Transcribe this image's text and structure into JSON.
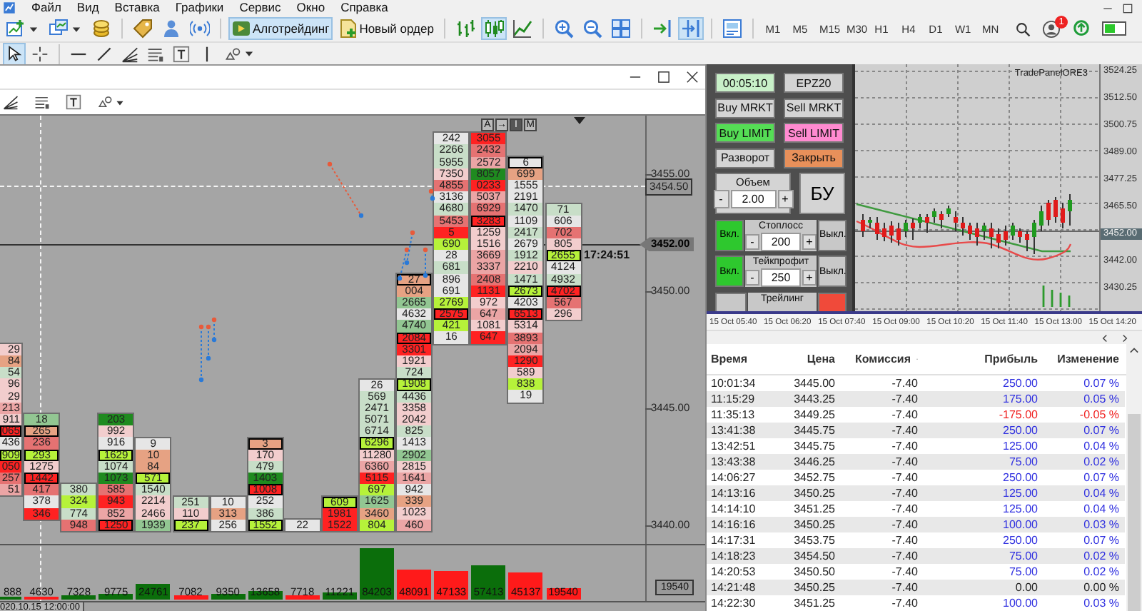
{
  "menu": {
    "items": [
      "Файл",
      "Вид",
      "Вставка",
      "Графики",
      "Сервис",
      "Окно",
      "Справка"
    ]
  },
  "toolbar": [
    {
      "kind": "new-chart",
      "pressed": false
    },
    {
      "kind": "profiles",
      "pressed": false
    },
    {
      "kind": "coins",
      "pressed": false
    },
    {
      "kind": "separator"
    },
    {
      "kind": "market",
      "pressed": false
    },
    {
      "kind": "person",
      "pressed": false
    },
    {
      "kind": "signal",
      "pressed": false
    },
    {
      "kind": "separator"
    },
    {
      "kind": "algo",
      "label": "Алготрейдинг",
      "pressed": true
    },
    {
      "kind": "order",
      "label": "Новый ордер",
      "pressed": false
    },
    {
      "kind": "separator"
    },
    {
      "kind": "bars",
      "pressed": false
    },
    {
      "kind": "candles",
      "pressed": true
    },
    {
      "kind": "line",
      "pressed": false
    },
    {
      "kind": "separator"
    },
    {
      "kind": "zoom-in",
      "pressed": false
    },
    {
      "kind": "zoom-out",
      "pressed": false
    },
    {
      "kind": "tile",
      "pressed": false
    },
    {
      "kind": "separator"
    },
    {
      "kind": "shift",
      "pressed": false
    },
    {
      "kind": "autoscroll",
      "pressed": true
    },
    {
      "kind": "separator"
    },
    {
      "kind": "template",
      "pressed": false
    },
    {
      "kind": "separator"
    }
  ],
  "timeframes": [
    {
      "label": "M1",
      "selected": false
    },
    {
      "label": "M5",
      "selected": false
    },
    {
      "label": "M15",
      "selected": false
    },
    {
      "label": "M30",
      "selected": false
    },
    {
      "label": "H1",
      "selected": false
    },
    {
      "label": "H4",
      "selected": false
    },
    {
      "label": "D1",
      "selected": false
    },
    {
      "label": "W1",
      "selected": false
    },
    {
      "label": "MN",
      "selected": false
    }
  ],
  "notifications": {
    "badge": "1"
  },
  "drawing_tools": [
    {
      "kind": "cursor",
      "pressed": true
    },
    {
      "kind": "crosshair",
      "pressed": false
    },
    {
      "kind": "separator"
    },
    {
      "kind": "hline",
      "pressed": false
    },
    {
      "kind": "trend",
      "pressed": false
    },
    {
      "kind": "fan",
      "pressed": false
    },
    {
      "kind": "levels",
      "pressed": false
    },
    {
      "kind": "text",
      "pressed": false
    },
    {
      "kind": "vline",
      "pressed": false
    },
    {
      "kind": "shapes",
      "pressed": false
    }
  ],
  "chart": {
    "mode_buttons": [
      {
        "label": "A",
        "pressed": false
      },
      {
        "label": "→",
        "pressed": false
      },
      {
        "label": "I",
        "pressed": true
      },
      {
        "label": "M",
        "pressed": false
      }
    ],
    "footprint": [
      {
        "cells": [
          {
            "value": "29",
            "color": "#f2cdcd",
            "boxed": false
          },
          {
            "value": "84",
            "color": "#e6a283",
            "boxed": false
          },
          {
            "value": "54",
            "color": "#c8dec8",
            "boxed": false
          },
          {
            "value": "96",
            "color": "#f2cdcd",
            "boxed": false
          },
          {
            "value": "29",
            "color": "#f2cdcd",
            "boxed": false
          },
          {
            "value": "213",
            "color": "#eba5a5",
            "boxed": false
          },
          {
            "value": "911",
            "color": "#f2cdcd",
            "boxed": false
          },
          {
            "value": "065",
            "color": "#ff2222",
            "boxed": true
          },
          {
            "value": "436",
            "color": "#e6e6e6",
            "boxed": false
          },
          {
            "value": "909",
            "color": "#b6f23a",
            "boxed": true
          },
          {
            "value": "050",
            "color": "#ff2222",
            "boxed": false
          },
          {
            "value": "257",
            "color": "#e57272",
            "boxed": false
          },
          {
            "value": "51",
            "color": "#eba5a5",
            "boxed": false
          }
        ]
      },
      {
        "cells": [
          {
            "value": "18",
            "color": "#92c692",
            "boxed": false
          },
          {
            "value": "265",
            "color": "#e6a283",
            "boxed": true
          },
          {
            "value": "236",
            "color": "#e57272",
            "boxed": false
          },
          {
            "value": "293",
            "color": "#b6f23a",
            "boxed": true
          },
          {
            "value": "1275",
            "color": "#f2cdcd",
            "boxed": false
          },
          {
            "value": "1442",
            "color": "#ff2222",
            "boxed": true
          },
          {
            "value": "417",
            "color": "#e57272",
            "boxed": false
          },
          {
            "value": "378",
            "color": "#e6e6e6",
            "boxed": false
          },
          {
            "value": "346",
            "color": "#ff2222",
            "boxed": false
          }
        ]
      },
      {
        "cells": [
          {
            "value": "380",
            "color": "#c8dec8",
            "boxed": false
          },
          {
            "value": "324",
            "color": "#b6f23a",
            "boxed": false
          },
          {
            "value": "774",
            "color": "#c8dec8",
            "boxed": false
          },
          {
            "value": "948",
            "color": "#e57272",
            "boxed": false
          }
        ]
      },
      {
        "cells": [
          {
            "value": "203",
            "color": "#1f8a1f",
            "boxed": false
          },
          {
            "value": "992",
            "color": "#f2cdcd",
            "boxed": false
          },
          {
            "value": "916",
            "color": "#e6e6e6",
            "boxed": false
          },
          {
            "value": "1629",
            "color": "#b6f23a",
            "boxed": true
          },
          {
            "value": "1074",
            "color": "#c8dec8",
            "boxed": false
          },
          {
            "value": "1073",
            "color": "#1f8a1f",
            "boxed": false
          },
          {
            "value": "585",
            "color": "#e57272",
            "boxed": false
          },
          {
            "value": "943",
            "color": "#ff2222",
            "boxed": false
          },
          {
            "value": "852",
            "color": "#eba5a5",
            "boxed": false
          },
          {
            "value": "1250",
            "color": "#ff2222",
            "boxed": true
          }
        ]
      },
      {
        "cells": [
          {
            "value": "9",
            "color": "#e6e6e6",
            "boxed": false
          },
          {
            "value": "10",
            "color": "#e6a283",
            "boxed": false
          },
          {
            "value": "84",
            "color": "#e6a283",
            "boxed": false
          },
          {
            "value": "571",
            "color": "#b6f23a",
            "boxed": true
          },
          {
            "value": "1540",
            "color": "#c8dec8",
            "boxed": false
          },
          {
            "value": "2214",
            "color": "#f2cdcd",
            "boxed": false
          },
          {
            "value": "2466",
            "color": "#f2cdcd",
            "boxed": false
          },
          {
            "value": "1939",
            "color": "#92c692",
            "boxed": false
          }
        ]
      },
      {
        "cells": [
          {
            "value": "251",
            "color": "#c8dec8",
            "boxed": false
          },
          {
            "value": "110",
            "color": "#f2cdcd",
            "boxed": false
          },
          {
            "value": "237",
            "color": "#b6f23a",
            "boxed": true
          }
        ]
      },
      {
        "cells": [
          {
            "value": "10",
            "color": "#e6e6e6",
            "boxed": false
          },
          {
            "value": "313",
            "color": "#e6a283",
            "boxed": false
          },
          {
            "value": "256",
            "color": "#e6e6e6",
            "boxed": false
          }
        ]
      },
      {
        "cells": [
          {
            "value": "3",
            "color": "#e6a283",
            "boxed": true
          },
          {
            "value": "170",
            "color": "#f2cdcd",
            "boxed": false
          },
          {
            "value": "479",
            "color": "#c8dec8",
            "boxed": false
          },
          {
            "value": "1403",
            "color": "#1f8a1f",
            "boxed": false
          },
          {
            "value": "1008",
            "color": "#ff2222",
            "boxed": true
          },
          {
            "value": "252",
            "color": "#e6e6e6",
            "boxed": false
          },
          {
            "value": "386",
            "color": "#c8dec8",
            "boxed": false
          },
          {
            "value": "1552",
            "color": "#b6f23a",
            "boxed": true
          }
        ]
      },
      {
        "cells": [
          {
            "value": "22",
            "color": "#e6e6e6",
            "boxed": false
          }
        ]
      },
      {
        "cells": [
          {
            "value": "609",
            "color": "#b6f23a",
            "boxed": true
          },
          {
            "value": "1981",
            "color": "#ff2222",
            "boxed": false
          },
          {
            "value": "1522",
            "color": "#ff2222",
            "boxed": false
          }
        ]
      },
      {
        "cells": [
          {
            "value": "26",
            "color": "#e6e6e6",
            "boxed": false
          },
          {
            "value": "569",
            "color": "#c8dec8",
            "boxed": false
          },
          {
            "value": "2471",
            "color": "#c8dec8",
            "boxed": false
          },
          {
            "value": "5071",
            "color": "#c8dec8",
            "boxed": false
          },
          {
            "value": "6714",
            "color": "#c8dec8",
            "boxed": false
          },
          {
            "value": "6296",
            "color": "#b6f23a",
            "boxed": true
          },
          {
            "value": "11280",
            "color": "#f2cdcd",
            "boxed": false
          },
          {
            "value": "6360",
            "color": "#eba5a5",
            "boxed": false
          },
          {
            "value": "5115",
            "color": "#ff2222",
            "boxed": false
          },
          {
            "value": "697",
            "color": "#b6f23a",
            "boxed": false
          },
          {
            "value": "1625",
            "color": "#92c692",
            "boxed": false
          },
          {
            "value": "3460",
            "color": "#e6a283",
            "boxed": false
          },
          {
            "value": "804",
            "color": "#b6f23a",
            "boxed": false
          }
        ]
      },
      {
        "cells": [
          {
            "value": "27",
            "color": "#e6a283",
            "boxed": true
          },
          {
            "value": "004",
            "color": "#e6a283",
            "boxed": false
          },
          {
            "value": "2665",
            "color": "#92c692",
            "boxed": false
          },
          {
            "value": "4632",
            "color": "#e6e6e6",
            "boxed": false
          },
          {
            "value": "4740",
            "color": "#92c692",
            "boxed": false
          },
          {
            "value": "2084",
            "color": "#ff2222",
            "boxed": true
          },
          {
            "value": "3301",
            "color": "#ff2222",
            "boxed": false
          },
          {
            "value": "1921",
            "color": "#f2cdcd",
            "boxed": false
          },
          {
            "value": "724",
            "color": "#c8dec8",
            "boxed": false
          },
          {
            "value": "1908",
            "color": "#b6f23a",
            "boxed": true
          },
          {
            "value": "4436",
            "color": "#c8dec8",
            "boxed": false
          },
          {
            "value": "3358",
            "color": "#f2cdcd",
            "boxed": false
          },
          {
            "value": "2042",
            "color": "#f2cdcd",
            "boxed": false
          },
          {
            "value": "825",
            "color": "#c8dec8",
            "boxed": false
          },
          {
            "value": "1413",
            "color": "#e6e6e6",
            "boxed": false
          },
          {
            "value": "2902",
            "color": "#92c692",
            "boxed": false
          },
          {
            "value": "2815",
            "color": "#f2cdcd",
            "boxed": false
          },
          {
            "value": "1641",
            "color": "#eba5a5",
            "boxed": false
          },
          {
            "value": "942",
            "color": "#e6e6e6",
            "boxed": false
          },
          {
            "value": "339",
            "color": "#e6a283",
            "boxed": false
          },
          {
            "value": "1023",
            "color": "#f2cdcd",
            "boxed": false
          },
          {
            "value": "460",
            "color": "#eba5a5",
            "boxed": false
          }
        ]
      },
      {
        "cells": [
          {
            "value": "242",
            "color": "#e6e6e6",
            "boxed": false
          },
          {
            "value": "2266",
            "color": "#c8dec8",
            "boxed": false
          },
          {
            "value": "5955",
            "color": "#c8dec8",
            "boxed": false
          },
          {
            "value": "7350",
            "color": "#f2cdcd",
            "boxed": false
          },
          {
            "value": "4855",
            "color": "#e57272",
            "boxed": false
          },
          {
            "value": "3136",
            "color": "#e6e6e6",
            "boxed": false
          },
          {
            "value": "4680",
            "color": "#c8dec8",
            "boxed": false
          },
          {
            "value": "5453",
            "color": "#e57272",
            "boxed": false
          },
          {
            "value": "5",
            "color": "#ff2222",
            "boxed": false
          },
          {
            "value": "690",
            "color": "#b6f23a",
            "boxed": false
          },
          {
            "value": "28",
            "color": "#e6e6e6",
            "boxed": false
          },
          {
            "value": "681",
            "color": "#c8dec8",
            "boxed": false
          },
          {
            "value": "896",
            "color": "#e6e6e6",
            "boxed": false
          },
          {
            "value": "691",
            "color": "#e6e6e6",
            "boxed": false
          },
          {
            "value": "2769",
            "color": "#b6f23a",
            "boxed": false
          },
          {
            "value": "2575",
            "color": "#ff2222",
            "boxed": true
          },
          {
            "value": "421",
            "color": "#b6f23a",
            "boxed": false
          },
          {
            "value": "16",
            "color": "#e6e6e6",
            "boxed": false
          }
        ]
      },
      {
        "cells": [
          {
            "value": "3055",
            "color": "#ff2222",
            "boxed": false
          },
          {
            "value": "2432",
            "color": "#e57272",
            "boxed": false
          },
          {
            "value": "2572",
            "color": "#eba5a5",
            "boxed": false
          },
          {
            "value": "8057",
            "color": "#1f8a1f",
            "boxed": false
          },
          {
            "value": "0233",
            "color": "#ff2222",
            "boxed": false
          },
          {
            "value": "5037",
            "color": "#eba5a5",
            "boxed": false
          },
          {
            "value": "6929",
            "color": "#e57272",
            "boxed": false
          },
          {
            "value": "3283",
            "color": "#ff2222",
            "boxed": true
          },
          {
            "value": "1259",
            "color": "#f2cdcd",
            "boxed": false
          },
          {
            "value": "1516",
            "color": "#f2cdcd",
            "boxed": false
          },
          {
            "value": "3669",
            "color": "#eba5a5",
            "boxed": false
          },
          {
            "value": "3337",
            "color": "#eba5a5",
            "boxed": false
          },
          {
            "value": "2408",
            "color": "#e57272",
            "boxed": false
          },
          {
            "value": "1131",
            "color": "#ff2222",
            "boxed": false
          },
          {
            "value": "972",
            "color": "#f2cdcd",
            "boxed": false
          },
          {
            "value": "647",
            "color": "#eba5a5",
            "boxed": false
          },
          {
            "value": "1081",
            "color": "#f2cdcd",
            "boxed": false
          },
          {
            "value": "647",
            "color": "#ff2222",
            "boxed": false
          }
        ]
      },
      {
        "cells": [
          {
            "value": "6",
            "color": "#e6e6e6",
            "boxed": true
          },
          {
            "value": "699",
            "color": "#e6a283",
            "boxed": false
          },
          {
            "value": "1555",
            "color": "#e6e6e6",
            "boxed": false
          },
          {
            "value": "2191",
            "color": "#e6e6e6",
            "boxed": false
          },
          {
            "value": "1470",
            "color": "#c8dec8",
            "boxed": false
          },
          {
            "value": "1109",
            "color": "#e6e6e6",
            "boxed": false
          },
          {
            "value": "2417",
            "color": "#c8dec8",
            "boxed": false
          },
          {
            "value": "2679",
            "color": "#e6e6e6",
            "boxed": false
          },
          {
            "value": "1912",
            "color": "#c8dec8",
            "boxed": false
          },
          {
            "value": "2210",
            "color": "#f2cdcd",
            "boxed": false
          },
          {
            "value": "1471",
            "color": "#c8dec8",
            "boxed": false
          },
          {
            "value": "2673",
            "color": "#b6f23a",
            "boxed": true
          },
          {
            "value": "4203",
            "color": "#e6e6e6",
            "boxed": false
          },
          {
            "value": "6513",
            "color": "#ff2222",
            "boxed": true
          },
          {
            "value": "5314",
            "color": "#f2cdcd",
            "boxed": false
          },
          {
            "value": "3893",
            "color": "#e57272",
            "boxed": false
          },
          {
            "value": "2094",
            "color": "#eba5a5",
            "boxed": false
          },
          {
            "value": "1290",
            "color": "#ff2222",
            "boxed": false
          },
          {
            "value": "589",
            "color": "#f2cdcd",
            "boxed": false
          },
          {
            "value": "838",
            "color": "#b6f23a",
            "boxed": false
          },
          {
            "value": "19",
            "color": "#e6e6e6",
            "boxed": false
          }
        ]
      },
      {
        "cells": [
          {
            "value": "71",
            "color": "#c8dec8",
            "boxed": false
          },
          {
            "value": "606",
            "color": "#e6e6e6",
            "boxed": false
          },
          {
            "value": "702",
            "color": "#e57272",
            "boxed": false
          },
          {
            "value": "805",
            "color": "#f2cdcd",
            "boxed": false
          },
          {
            "value": "2655",
            "color": "#b6f23a",
            "boxed": true
          },
          {
            "value": "4124",
            "color": "#e6e6e6",
            "boxed": false
          },
          {
            "value": "4932",
            "color": "#c8dec8",
            "boxed": false
          },
          {
            "value": "4702",
            "color": "#ff2222",
            "boxed": true
          },
          {
            "value": "567",
            "color": "#e57272",
            "boxed": false
          },
          {
            "value": "296",
            "color": "#f2cdcd",
            "boxed": false
          }
        ]
      }
    ],
    "price_axis": [
      {
        "label": "3455.00",
        "kind": "tick"
      },
      {
        "label": "3454.50",
        "kind": "marker"
      },
      {
        "label": "3452.00",
        "kind": "current"
      },
      {
        "label": "3450.00",
        "kind": "tick"
      },
      {
        "label": "3445.00",
        "kind": "tick"
      },
      {
        "label": "3440.00",
        "kind": "tick"
      }
    ],
    "clock": "17:24:51",
    "volume": [
      {
        "value": "888",
        "color": "#0b6e0b"
      },
      {
        "value": "4630",
        "color": "#ff1a1a"
      },
      {
        "value": "7328",
        "color": "#0b6e0b"
      },
      {
        "value": "9775",
        "color": "#0b6e0b"
      },
      {
        "value": "24761",
        "color": "#0b6e0b"
      },
      {
        "value": "7082",
        "color": "#ff1a1a"
      },
      {
        "value": "9350",
        "color": "#0b6e0b"
      },
      {
        "value": "13658",
        "color": "#0b6e0b"
      },
      {
        "value": "7718",
        "color": "#ff1a1a"
      },
      {
        "value": "11221",
        "color": "#0b6e0b"
      },
      {
        "value": "84203",
        "color": "#0b6e0b"
      },
      {
        "value": "48091",
        "color": "#ff1a1a"
      },
      {
        "value": "47133",
        "color": "#ff1a1a"
      },
      {
        "value": "57413",
        "color": "#0b6e0b"
      },
      {
        "value": "45137",
        "color": "#ff1a1a"
      },
      {
        "value": "19540",
        "color": "#ff1a1a"
      }
    ],
    "volume_axis": "19540",
    "date_label": "020.10.15 12:00:00"
  },
  "trade_panel": {
    "buttons": [
      {
        "label": "00:05:10",
        "color": "#c8f0c8"
      },
      {
        "label": "EPZ20",
        "color": "#d4d4d4"
      },
      {
        "label": "Buy MRKT",
        "color": "#d4d4d4"
      },
      {
        "label": "Sell MRKT",
        "color": "#d4d4d4"
      },
      {
        "label": "Buy LIMIT",
        "color": "#55dd55"
      },
      {
        "label": "Sell LIMIT",
        "color": "#ff8ad0"
      },
      {
        "label": "Разворот",
        "color": "#d4d4d4"
      },
      {
        "label": "Закрыть",
        "color": "#e8905a"
      }
    ],
    "volume": {
      "label": "Объем",
      "minus": "-",
      "value": "2.00",
      "plus": "+"
    },
    "breakeven": "БУ",
    "rows": [
      {
        "on_label": "Вкл.",
        "label": "Стоплосс",
        "minus": "-",
        "value": "200",
        "plus": "+",
        "off_label": "Выкл.",
        "enabled": true
      },
      {
        "on_label": "Вкл.",
        "label": "Тейкпрофит",
        "minus": "-",
        "value": "250",
        "plus": "+",
        "off_label": "Выкл.",
        "enabled": true
      },
      {
        "label": "Трейлинг",
        "enabled": false
      }
    ]
  },
  "mini_chart": {
    "title": "TradePanelORE3",
    "price_axis": [
      {
        "label": "3524.25",
        "kind": "tick"
      },
      {
        "label": "3512.50",
        "kind": "tick"
      },
      {
        "label": "3500.75",
        "kind": "tick"
      },
      {
        "label": "3489.00",
        "kind": "tick"
      },
      {
        "label": "3477.25",
        "kind": "tick"
      },
      {
        "label": "3465.50",
        "kind": "tick"
      },
      {
        "label": "3452.00",
        "kind": "current"
      },
      {
        "label": "3442.00",
        "kind": "tick"
      },
      {
        "label": "3430.25",
        "kind": "tick"
      }
    ],
    "time_axis": [
      "15 Oct 05:40",
      "15 Oct 06:20",
      "15 Oct 07:40",
      "15 Oct 09:00",
      "15 Oct 10:20",
      "15 Oct 11:40",
      "15 Oct 13:00",
      "15 Oct 14:20"
    ]
  },
  "trades": {
    "columns": [
      {
        "label": "Время",
        "sorted": false
      },
      {
        "label": "Цена",
        "sorted": false
      },
      {
        "label": "Комиссия",
        "sorted": true
      },
      {
        "label": "Прибыль",
        "sorted": false
      },
      {
        "label": "Изменение",
        "sorted": false
      }
    ],
    "rows": [
      {
        "time": "10:01:34",
        "price": "3445.00",
        "commission": "-7.40",
        "profit": "250.00",
        "change": "0.07 %",
        "color": "#3030e0"
      },
      {
        "time": "11:15:29",
        "price": "3443.25",
        "commission": "-7.40",
        "profit": "175.00",
        "change": "0.05 %",
        "color": "#3030e0"
      },
      {
        "time": "11:35:13",
        "price": "3449.25",
        "commission": "-7.40",
        "profit": "-175.00",
        "change": "-0.05 %",
        "color": "#f02020"
      },
      {
        "time": "13:41:38",
        "price": "3445.75",
        "commission": "-7.40",
        "profit": "250.00",
        "change": "0.07 %",
        "color": "#3030e0"
      },
      {
        "time": "13:42:51",
        "price": "3445.75",
        "commission": "-7.40",
        "profit": "125.00",
        "change": "0.04 %",
        "color": "#3030e0"
      },
      {
        "time": "13:43:38",
        "price": "3446.25",
        "commission": "-7.40",
        "profit": "75.00",
        "change": "0.02 %",
        "color": "#3030e0"
      },
      {
        "time": "14:06:27",
        "price": "3452.75",
        "commission": "-7.40",
        "profit": "250.00",
        "change": "0.07 %",
        "color": "#3030e0"
      },
      {
        "time": "14:13:16",
        "price": "3450.25",
        "commission": "-7.40",
        "profit": "125.00",
        "change": "0.04 %",
        "color": "#3030e0"
      },
      {
        "time": "14:14:10",
        "price": "3451.25",
        "commission": "-7.40",
        "profit": "125.00",
        "change": "0.04 %",
        "color": "#3030e0"
      },
      {
        "time": "14:16:16",
        "price": "3450.25",
        "commission": "-7.40",
        "profit": "100.00",
        "change": "0.03 %",
        "color": "#3030e0"
      },
      {
        "time": "14:17:31",
        "price": "3453.75",
        "commission": "-7.40",
        "profit": "250.00",
        "change": "0.07 %",
        "color": "#3030e0"
      },
      {
        "time": "14:18:23",
        "price": "3454.50",
        "commission": "-7.40",
        "profit": "75.00",
        "change": "0.02 %",
        "color": "#3030e0"
      },
      {
        "time": "14:20:53",
        "price": "3450.50",
        "commission": "-7.40",
        "profit": "75.00",
        "change": "0.02 %",
        "color": "#3030e0"
      },
      {
        "time": "14:21:48",
        "price": "3450.25",
        "commission": "-7.40",
        "profit": "0.00",
        "change": "0.00 %",
        "color": "#222222"
      },
      {
        "time": "14:22:30",
        "price": "3451.25",
        "commission": "-7.40",
        "profit": "100.00",
        "change": "0.03 %",
        "color": "#3030e0"
      }
    ]
  }
}
